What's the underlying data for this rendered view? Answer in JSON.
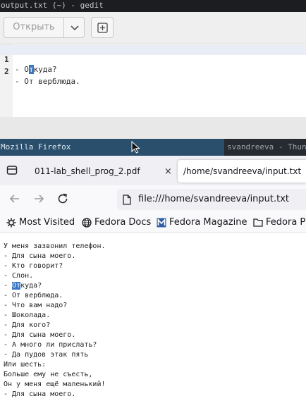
{
  "gedit": {
    "title": "output.txt (~) - gedit",
    "open_label": "Открыть",
    "lines": [
      {
        "num": "1",
        "prefix": "- О",
        "cursor": "т",
        "rest": "куда?"
      },
      {
        "num": "2",
        "text": "- От верблюда."
      }
    ]
  },
  "firefox": {
    "window_title": "Mozilla Firefox",
    "other_window_title": "svandreeva - Thun",
    "tabs": [
      {
        "label": "011-lab_shell_prog_2.pdf",
        "close": "×"
      },
      {
        "label": "/home/svandreeva/input.txt"
      }
    ],
    "url": "file:///home/svandreeva/input.txt",
    "bookmarks": [
      "Most Visited",
      "Fedora Docs",
      "Fedora Magazine",
      "Fedora Pr"
    ],
    "content": {
      "line_first": "У меня зазвонил телефон.",
      "lines_before": [
        "- Для сына моего.",
        "- Кто говорит?",
        "- Слон."
      ],
      "match_prefix": "- ",
      "match": "От",
      "match_rest": "куда?",
      "lines_after": [
        "- От верблюда.",
        "- Что вам надо?",
        "- Шоколада.",
        "- Для кого?",
        "- Для сына моего.",
        "- А много ли прислать?",
        "- Да пудов этак пять",
        "Или шесть:",
        "Больше ему не съесть,",
        "Он у меня ещё маленький!",
        "- Для сына моего."
      ]
    }
  },
  "colors": {
    "highlight": "#3b76c4",
    "firefox_titlebar": "#2a4f6c",
    "gedit_titlebar": "#1b1d21"
  }
}
